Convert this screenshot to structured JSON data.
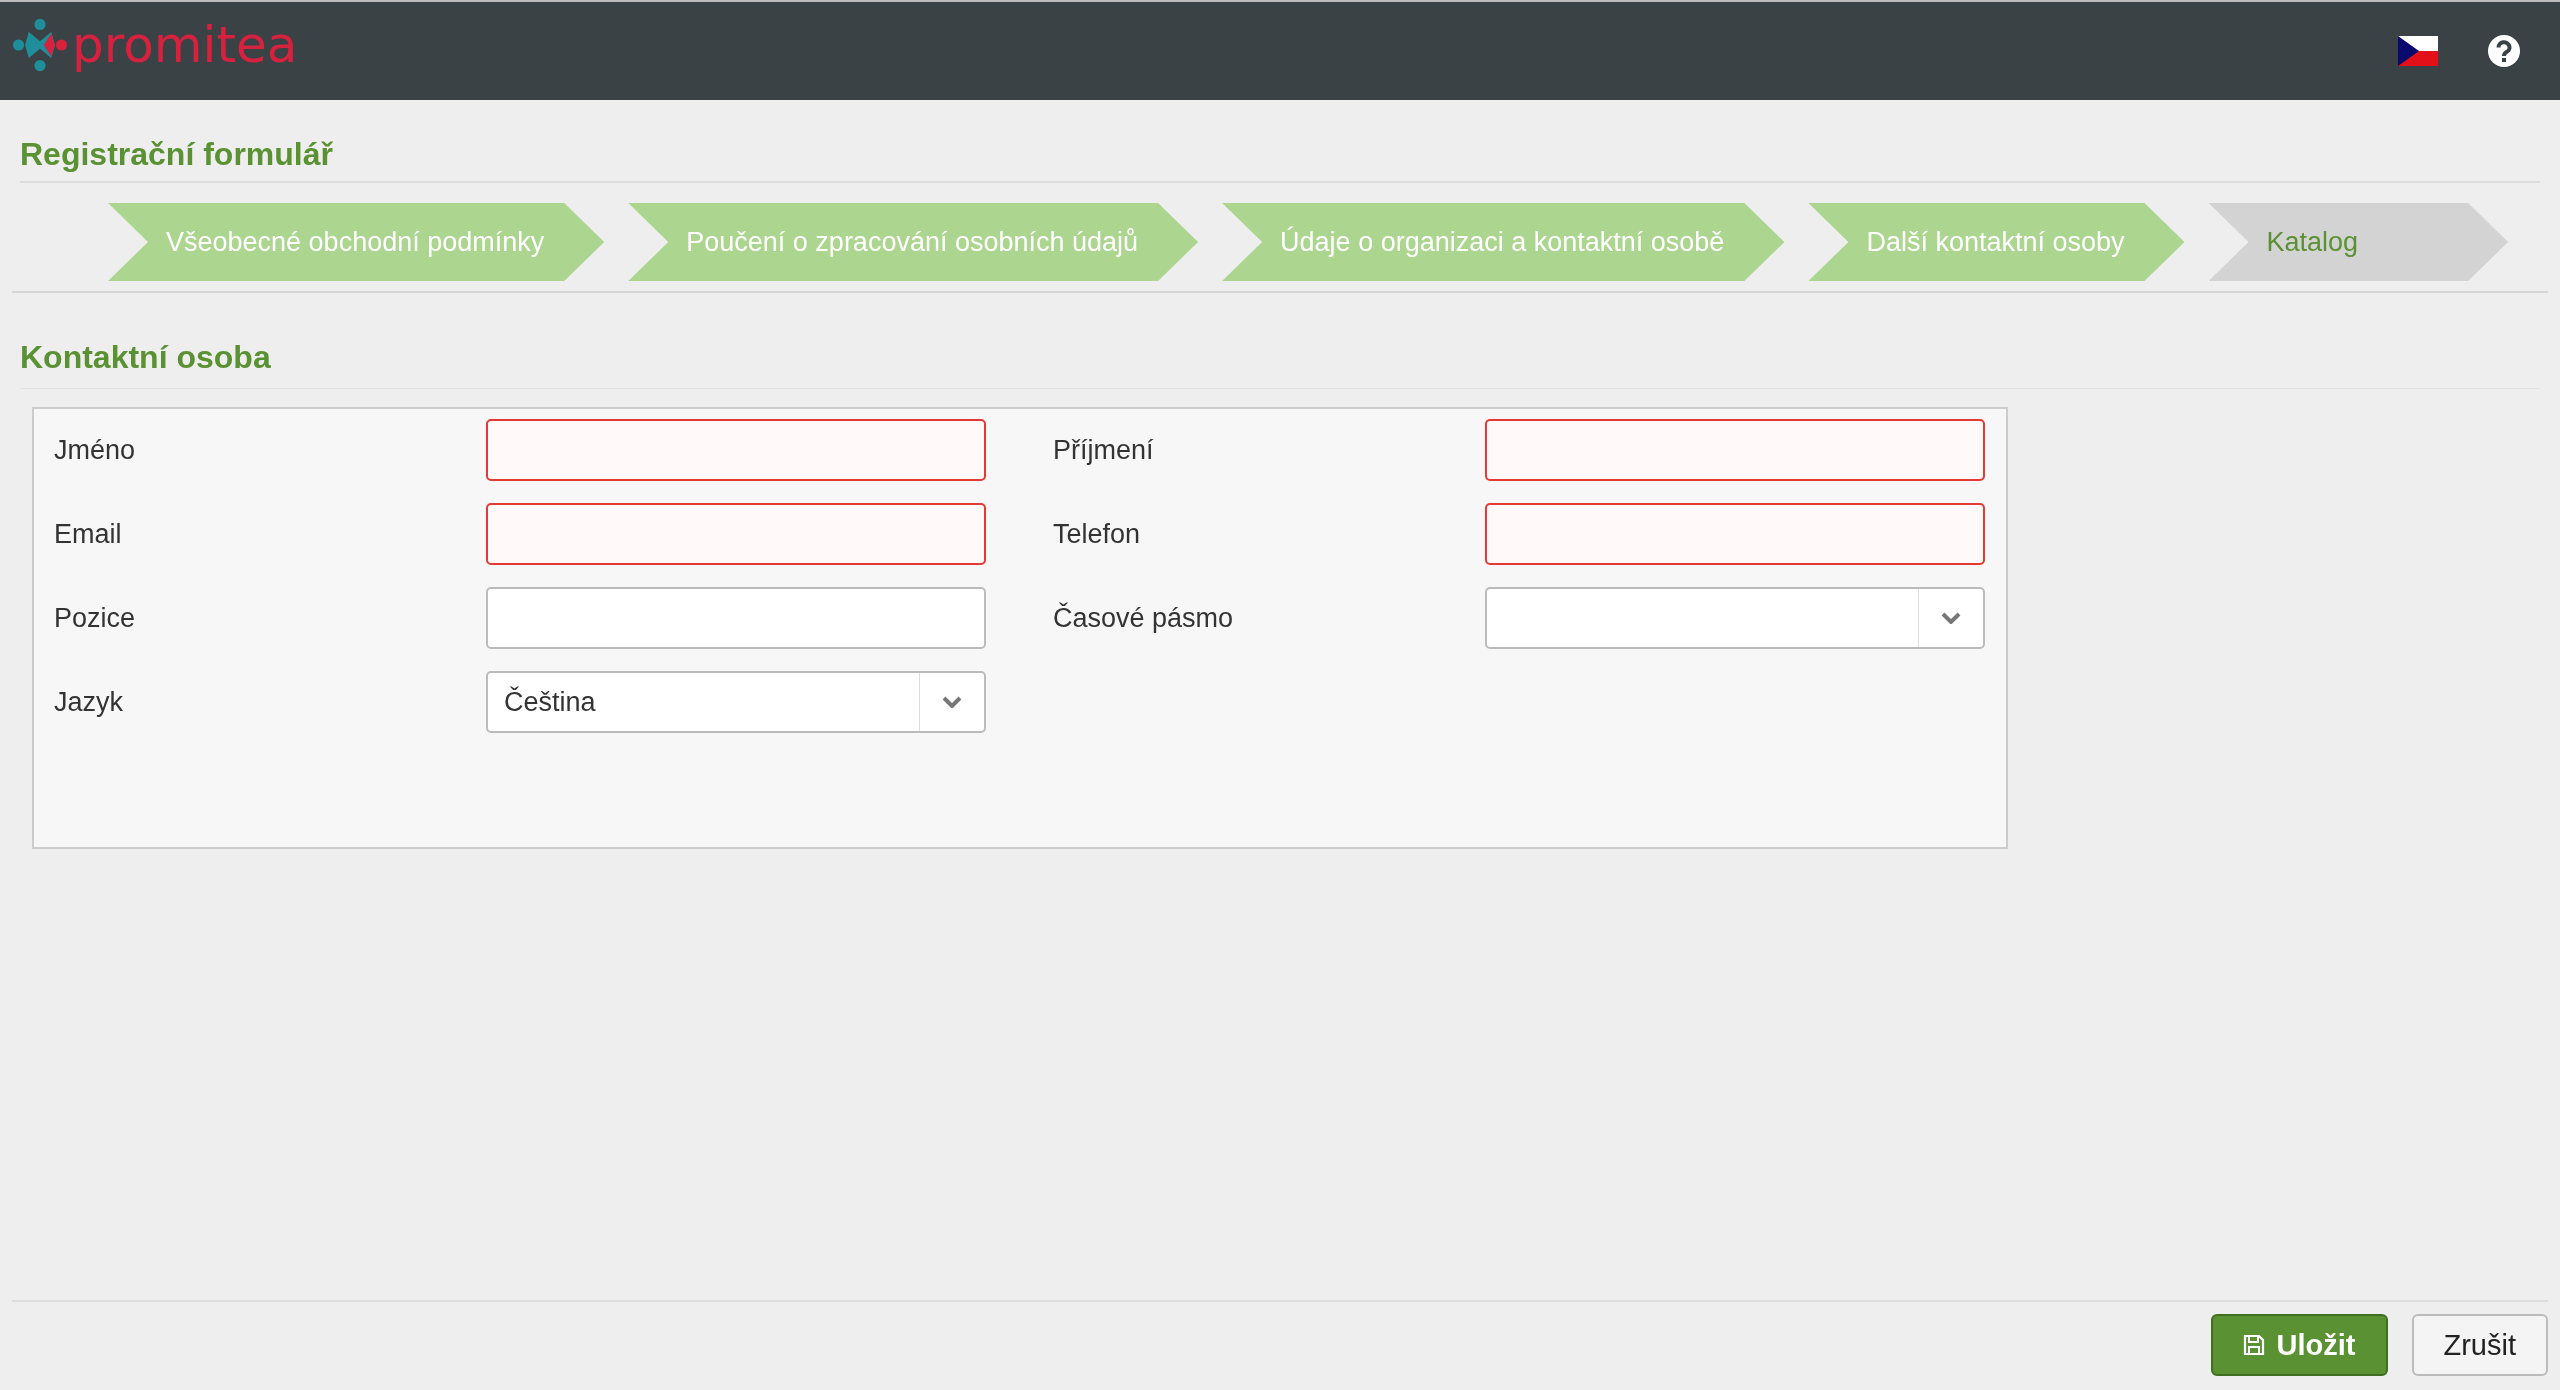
{
  "header": {
    "logo": "promitea"
  },
  "page_title": "Registrační formulář",
  "steps": [
    {
      "label": "Všeobecné obchodní podmínky",
      "completed": true
    },
    {
      "label": "Poučení o zpracování osobních údajů",
      "completed": true
    },
    {
      "label": "Údaje o organizaci a kontaktní osobě",
      "completed": true
    },
    {
      "label": "Další kontaktní osoby",
      "completed": true
    },
    {
      "label": "Katalog",
      "completed": false
    }
  ],
  "section_title": "Kontaktní osoba",
  "fields": [
    {
      "label": "Jméno",
      "kind": "text",
      "required": true
    },
    {
      "label": "Příjmení",
      "kind": "text",
      "required": true
    },
    {
      "label": "Email",
      "kind": "text",
      "required": true
    },
    {
      "label": "Telefon",
      "kind": "text",
      "required": true
    },
    {
      "label": "Pozice",
      "kind": "text",
      "required": false
    },
    {
      "label": "Časové pásmo",
      "kind": "select",
      "required": false
    },
    {
      "label": "Jazyk",
      "kind": "select",
      "required": false,
      "value": "Čeština"
    }
  ],
  "buttons": {
    "save": "Uložit",
    "cancel": "Zrušit"
  }
}
